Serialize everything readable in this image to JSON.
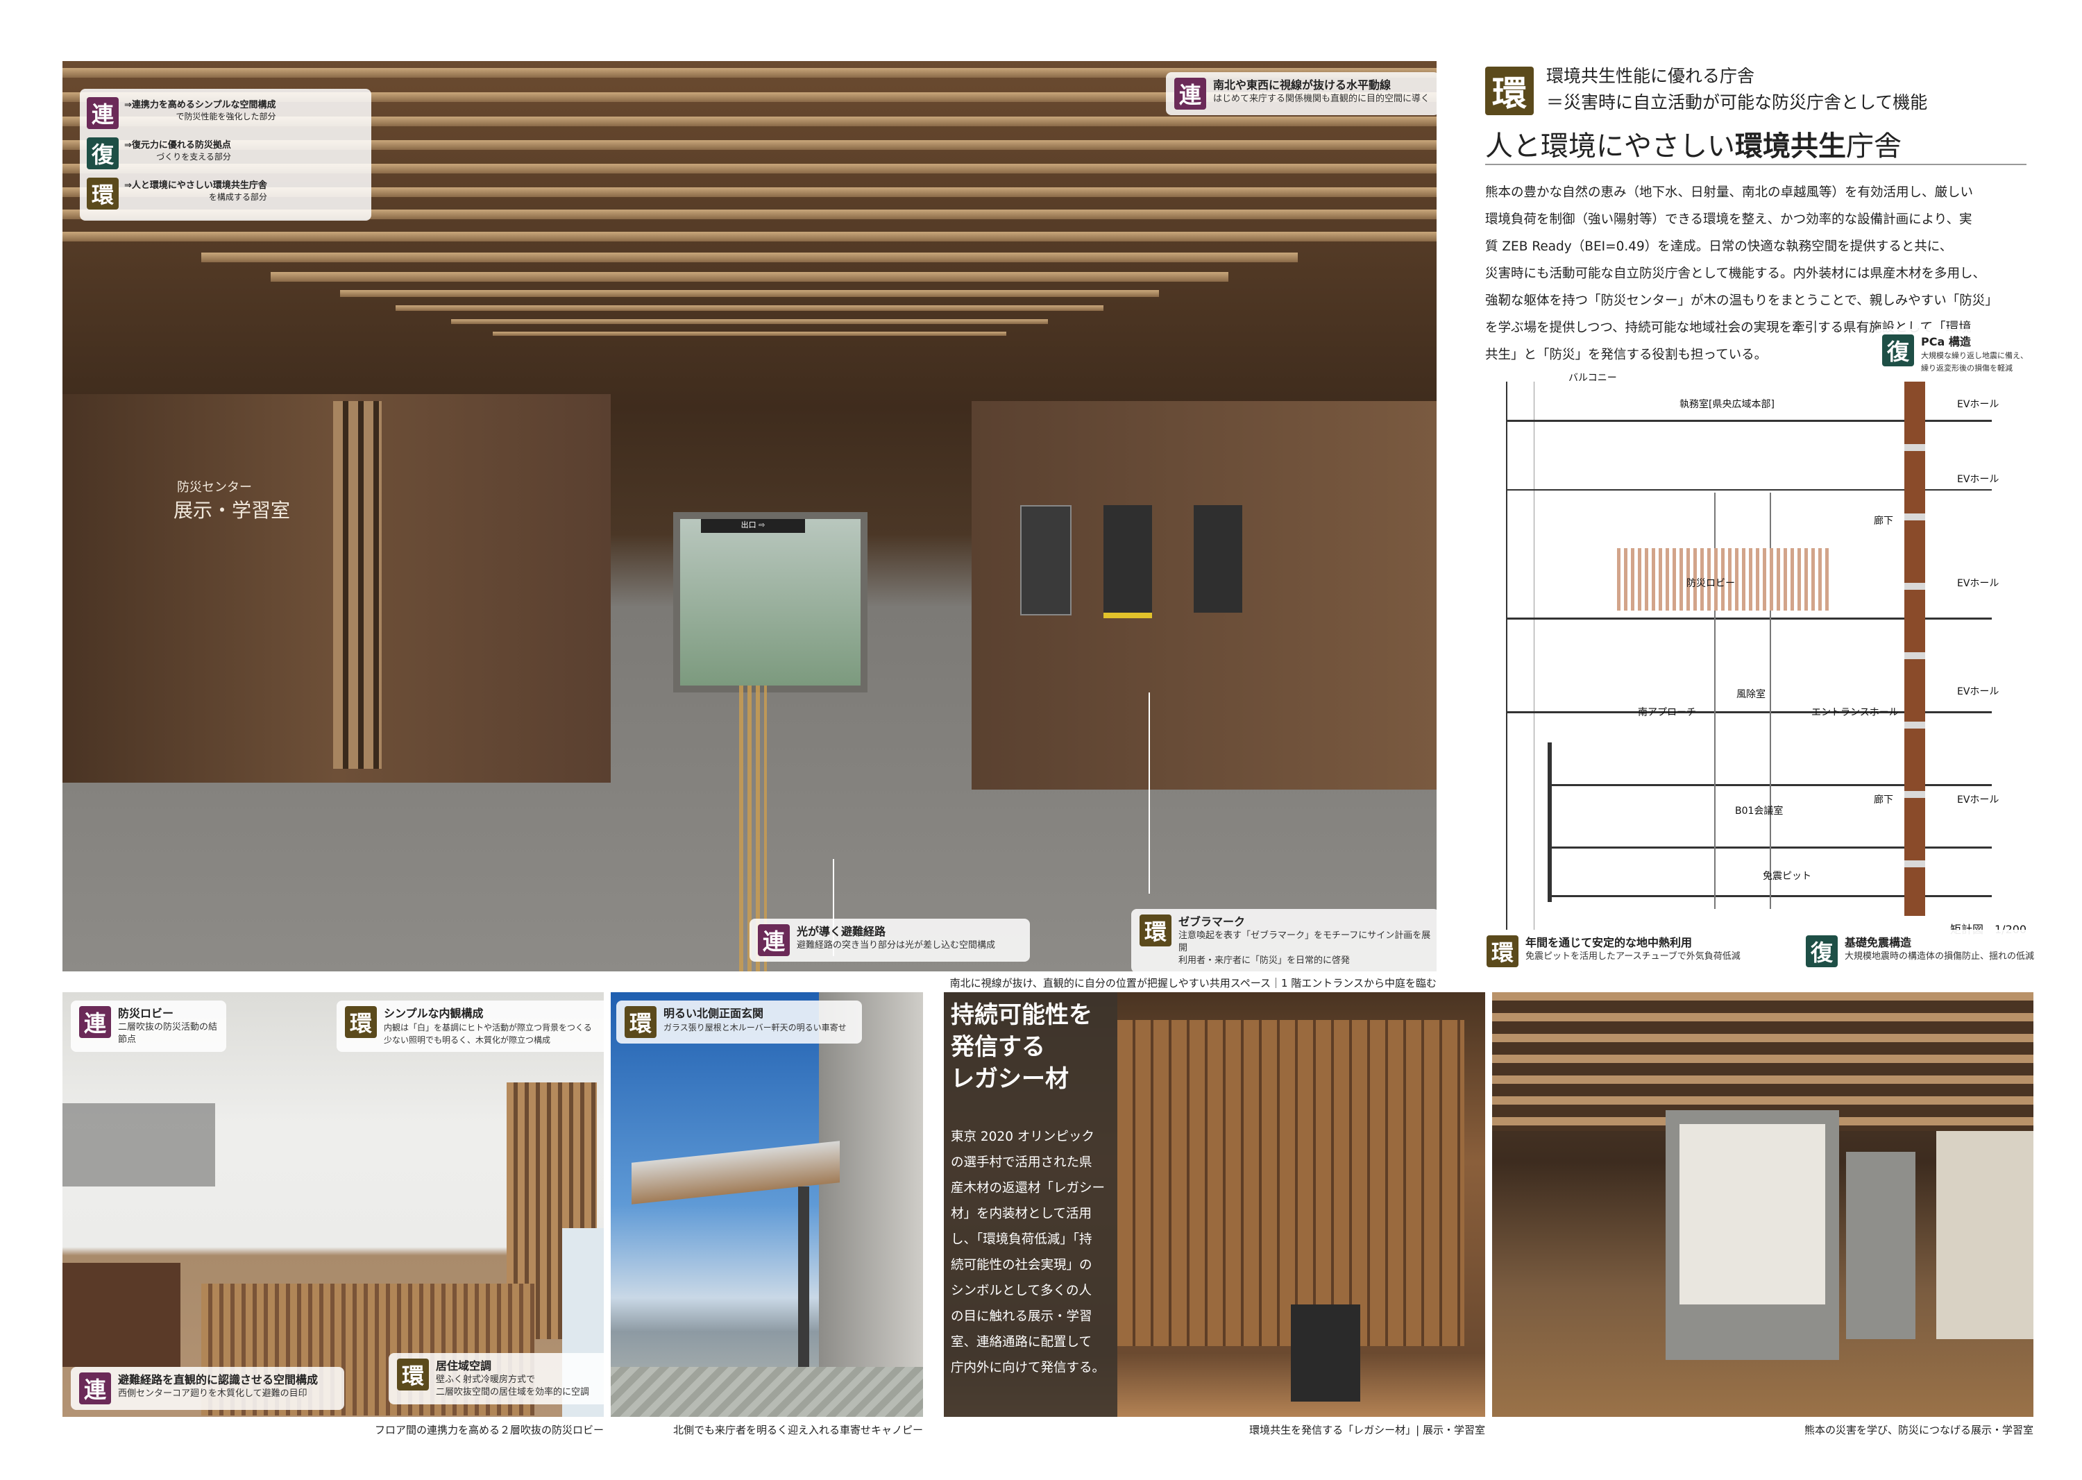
{
  "header": {
    "kanji": "環",
    "line1": "環境共生性能に優れる庁舎",
    "line2": "＝災害時に自立活動が可能な防災庁舎として機能",
    "title_pre": "人と環境にやさしい",
    "title_bold": "環境共生",
    "title_post": "庁舎"
  },
  "body_text": [
    "熊本の豊かな自然の恵み（地下水、日射量、南北の卓越風等）を有効活用し、厳しい",
    "環境負荷を制御（強い陽射等）できる環境を整え、かつ効率的な設備計画により、実",
    "質 ZEB Ready（BEI=0.49）を達成。日常の快適な執務空間を提供すると共に、",
    "災害時にも活動可能な自立防災庁舎として機能する。内外装材には県産木材を多用し、",
    "強靭な躯体を持つ「防災センター」が木の温もりをまとうことで、親しみやすい「防災」",
    "を学ぶ場を提供しつつ、持続可能な地域社会の実現を牽引する県有施設として「環境",
    "共生」と「防災」を発信する役割も担っている。"
  ],
  "legend": [
    {
      "kanji": "連",
      "title": "⇒連携力を高めるシンプルな空間構成",
      "sub": "で防災性能を強化した部分"
    },
    {
      "kanji": "復",
      "title": "⇒復元力に優れる防災拠点",
      "sub": "づくりを支える部分"
    },
    {
      "kanji": "環",
      "title": "⇒人と環境にやさしい環境共生庁舎",
      "sub": "を構成する部分"
    }
  ],
  "main_photo": {
    "tag_top": {
      "kanji": "連",
      "title": "南北や東西に視線が抜ける水平動線",
      "sub": "はじめて来庁する関係機関も直観的に目的空間に導く"
    },
    "room_sign_small": "防災センター",
    "room_sign_large": "展示・学習室",
    "tag_route": {
      "kanji": "連",
      "title": "光が導く避難経路",
      "sub": "避難経路の突き当り部分は光が差し込む空間構成"
    },
    "tag_zebra": {
      "kanji": "環",
      "title": "ゼブラマーク",
      "sub1": "注意喚起を表す「ゼブラマーク」をモチーフにサイン計画を展開",
      "sub2": "利用者・来庁者に「防災」を日常的に啓発"
    },
    "caption": "南北に視線が抜け、直観的に自分の位置が把握しやすい共用スペース｜1 階エントランスから中庭を臨む",
    "door_sign": "出口 ⇨"
  },
  "section": {
    "tag_pca": {
      "kanji": "復",
      "title": "PCa 構造",
      "sub1": "大規模な繰り返し地震に備え、",
      "sub2": "繰り返変形後の損傷を軽減"
    },
    "tag_geo": {
      "kanji": "環",
      "title": "年間を通じて安定的な地中熱利用",
      "sub": "免震ピットを活用したアースチューブで外気負荷低減"
    },
    "tag_iso": {
      "kanji": "復",
      "title": "基礎免震構造",
      "sub": "大規模地震時の構造体の損傷防止、揺れの低減"
    },
    "scale": "矩計図　1/200",
    "labels": [
      "バルコニー",
      "執務室[県央広域本部]",
      "EVホール",
      "EVホール",
      "廊下",
      "防災ロビー",
      "EVホール",
      "風除室",
      "南アプローチ",
      "エントランスホール",
      "EVホール",
      "B01会議室",
      "廊下",
      "EVホール",
      "免震ピット"
    ]
  },
  "lobby_photo": {
    "tag1": {
      "kanji": "連",
      "title": "防災ロビー",
      "sub": "二層吹抜の防災活動の結節点"
    },
    "tag2": {
      "kanji": "環",
      "title": "シンプルな内観構成",
      "sub1": "内観は「白」を基調にヒトや活動が際立つ背景をつくる",
      "sub2": "少ない照明でも明るく、木質化が際立つ構成"
    },
    "tag3": {
      "kanji": "連",
      "title": "避難経路を直観的に認識させる空間構成",
      "sub": "西側センターコア廻りを木質化して避難の目印"
    },
    "tag4": {
      "kanji": "環",
      "title": "居住域空調",
      "sub1": "壁ふく射式冷暖房方式で",
      "sub2": "二層吹抜空間の居住域を効率的に空調"
    },
    "caption": "フロア間の連携力を高める２層吹抜の防災ロビー"
  },
  "canopy_photo": {
    "tag": {
      "kanji": "環",
      "title": "明るい北側正面玄関",
      "sub": "ガラス張り屋根と木ルーバー軒天の明るい車寄せ"
    },
    "caption": "北側でも来庁者を明るく迎え入れる車寄せキャノピー"
  },
  "legacy": {
    "heading": [
      "持続可能性を",
      "発信する",
      "レガシー材"
    ],
    "text": [
      "東京 2020 オリンピック",
      "の選手村で活用された県",
      "産木材の返還材「レガシー",
      "材」を内装材として活用",
      "し、「環境負荷低減」「持",
      "続可能性の社会実現」の",
      "シンボルとして多くの人",
      "の目に触れる展示・学習",
      "室、連絡通路に配置して",
      "庁内外に向けて発信する。"
    ],
    "caption": "環境共生を発信する「レガシー材」| 展示・学習室"
  },
  "exhibit_photo": {
    "caption": "熊本の災害を学び、防災につなげる展示・学習室"
  },
  "colors": {
    "ren": "#6b2a58",
    "fuku": "#1e4f46",
    "kan": "#5b4a1c"
  }
}
